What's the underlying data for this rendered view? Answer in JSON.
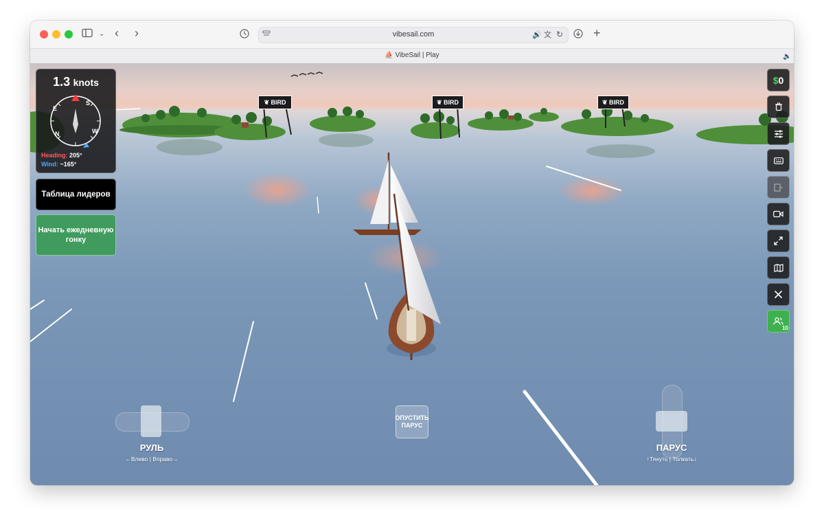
{
  "browser": {
    "url": "vibesail.com",
    "tab_title": "VibeSail | Play"
  },
  "hud": {
    "speed_value": "1.3",
    "speed_unit": "knots",
    "compass_letters": [
      "S",
      "W",
      "N",
      "E"
    ],
    "heading_label": "Heading:",
    "heading_value": "205°",
    "wind_label": "Wind:",
    "wind_value": "~165°",
    "heading_color": "#ff5a5a",
    "wind_color": "#4ea8ff"
  },
  "buttons": {
    "leaderboard": "Таблица лидеров",
    "daily_race": "Начать ежедневную гонку"
  },
  "right_toolbar": {
    "currency_symbol": "$",
    "currency_amount": "0",
    "players_count": "10"
  },
  "controls": {
    "rudder_label": "РУЛЬ",
    "rudder_hint": "←Влево | Вправо→",
    "sail_label": "ПАРУС",
    "sail_hint": "↑Тянуть | Толкать↓",
    "lower_sail": "ОПУСТИТЬ ПАРУС"
  },
  "billboards": [
    "BIRD",
    "BIRD",
    "BIRD"
  ],
  "colors": {
    "green_button": "#3f9b5e",
    "players_button": "#3fb04f",
    "currency": "#4cd264"
  }
}
